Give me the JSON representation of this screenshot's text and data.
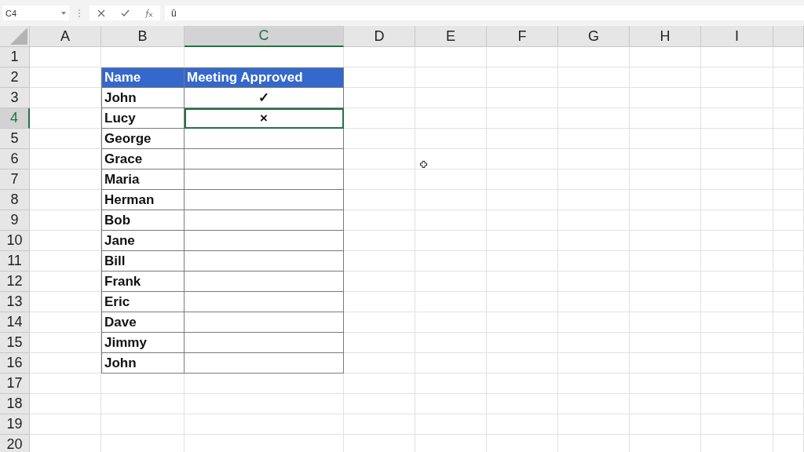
{
  "formula_bar": {
    "name_box": "C4",
    "formula": "û"
  },
  "columns": [
    {
      "label": "A",
      "selected": false
    },
    {
      "label": "B",
      "selected": false
    },
    {
      "label": "C",
      "selected": true
    },
    {
      "label": "D",
      "selected": false
    },
    {
      "label": "E",
      "selected": false
    },
    {
      "label": "F",
      "selected": false
    },
    {
      "label": "G",
      "selected": false
    },
    {
      "label": "H",
      "selected": false
    },
    {
      "label": "I",
      "selected": false
    }
  ],
  "rows": [
    {
      "label": "1",
      "selected": false
    },
    {
      "label": "2",
      "selected": false
    },
    {
      "label": "3",
      "selected": false
    },
    {
      "label": "4",
      "selected": true
    },
    {
      "label": "5",
      "selected": false
    },
    {
      "label": "6",
      "selected": false
    },
    {
      "label": "7",
      "selected": false
    },
    {
      "label": "8",
      "selected": false
    },
    {
      "label": "9",
      "selected": false
    },
    {
      "label": "10",
      "selected": false
    },
    {
      "label": "11",
      "selected": false
    },
    {
      "label": "12",
      "selected": false
    },
    {
      "label": "13",
      "selected": false
    },
    {
      "label": "14",
      "selected": false
    },
    {
      "label": "15",
      "selected": false
    },
    {
      "label": "16",
      "selected": false
    },
    {
      "label": "17",
      "selected": false
    },
    {
      "label": "18",
      "selected": false
    },
    {
      "label": "19",
      "selected": false
    },
    {
      "label": "20",
      "selected": false
    }
  ],
  "table": {
    "header": [
      "Name",
      "Meeting Approved"
    ],
    "rows": [
      {
        "name": "John",
        "approved": "✓"
      },
      {
        "name": "Lucy",
        "approved": "×"
      },
      {
        "name": "George"
      },
      {
        "name": "Grace"
      },
      {
        "name": "Maria"
      },
      {
        "name": "Herman"
      },
      {
        "name": "Bob"
      },
      {
        "name": "Jane"
      },
      {
        "name": "Bill"
      },
      {
        "name": "Frank"
      },
      {
        "name": "Eric"
      },
      {
        "name": "Dave"
      },
      {
        "name": "Jimmy"
      },
      {
        "name": "John"
      }
    ]
  }
}
